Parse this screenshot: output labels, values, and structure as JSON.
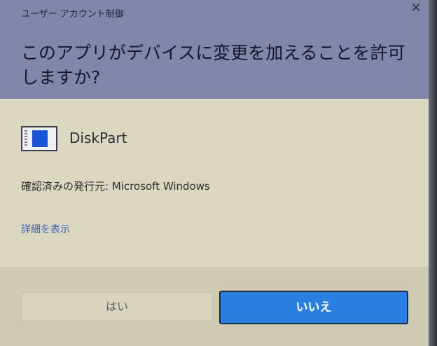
{
  "window": {
    "title": "ユーザー アカウント制御",
    "close_glyph": "✕"
  },
  "prompt": {
    "question": "このアプリがデバイスに変更を加えることを許可しますか?"
  },
  "app": {
    "name": "DiskPart",
    "icon": "disk-management-icon",
    "publisher": "確認済みの発行元: Microsoft Windows",
    "details_link": "詳細を表示"
  },
  "buttons": {
    "yes_label": "はい",
    "no_label": "いいえ"
  },
  "colors": {
    "header_bg": "#8286a9",
    "body_bg": "#dcd7c0",
    "primary_button": "#2b7fe0",
    "link": "#3b5faf"
  }
}
